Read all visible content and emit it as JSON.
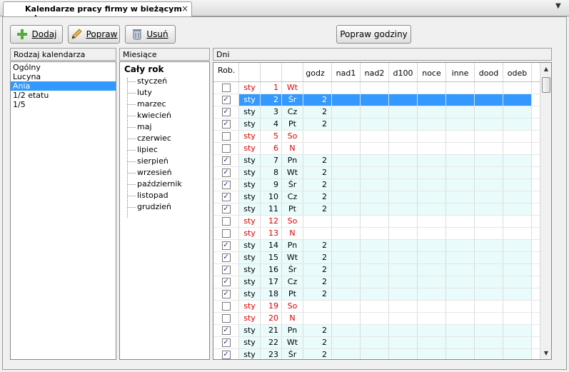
{
  "tab": {
    "title": "Kalendarze pracy firmy w bieżącym roku",
    "close": "×",
    "menu": "▼"
  },
  "toolbar": {
    "add_label": "Dodaj",
    "add_icon": "plus-icon",
    "edit_label": "Popraw",
    "edit_icon": "pencil-icon",
    "delete_label": "Usuń",
    "delete_icon": "trash-icon",
    "hours_label": "Popraw godziny"
  },
  "calendars": {
    "header": "Rodzaj kalendarza",
    "items": [
      "Ogólny",
      "Lucyna",
      "Ania",
      "1/2 etatu",
      "1/5"
    ],
    "selected": "Ania"
  },
  "months": {
    "header": "Miesiące",
    "root": "Cały rok",
    "items": [
      "styczeń",
      "luty",
      "marzec",
      "kwiecień",
      "maj",
      "czerwiec",
      "lipiec",
      "sierpień",
      "wrzesień",
      "październik",
      "listopad",
      "grudzień"
    ]
  },
  "days": {
    "header": "Dni",
    "columns": [
      "Rob.",
      "",
      "",
      "",
      "godz",
      "nad1",
      "nad2",
      "d100",
      "noce",
      "inne",
      "dood",
      "odeb"
    ],
    "rows": [
      {
        "checked": false,
        "month": "sty",
        "day": "1",
        "weekday": "Wt",
        "hours": "",
        "type": "off"
      },
      {
        "checked": true,
        "month": "sty",
        "day": "2",
        "weekday": "Śr",
        "hours": "2",
        "type": "selected"
      },
      {
        "checked": true,
        "month": "sty",
        "day": "3",
        "weekday": "Cz",
        "hours": "2",
        "type": "work"
      },
      {
        "checked": true,
        "month": "sty",
        "day": "4",
        "weekday": "Pt",
        "hours": "2",
        "type": "work"
      },
      {
        "checked": false,
        "month": "sty",
        "day": "5",
        "weekday": "So",
        "hours": "",
        "type": "off"
      },
      {
        "checked": false,
        "month": "sty",
        "day": "6",
        "weekday": "N",
        "hours": "",
        "type": "off"
      },
      {
        "checked": true,
        "month": "sty",
        "day": "7",
        "weekday": "Pn",
        "hours": "2",
        "type": "work"
      },
      {
        "checked": true,
        "month": "sty",
        "day": "8",
        "weekday": "Wt",
        "hours": "2",
        "type": "work"
      },
      {
        "checked": true,
        "month": "sty",
        "day": "9",
        "weekday": "Śr",
        "hours": "2",
        "type": "work"
      },
      {
        "checked": true,
        "month": "sty",
        "day": "10",
        "weekday": "Cz",
        "hours": "2",
        "type": "work"
      },
      {
        "checked": true,
        "month": "sty",
        "day": "11",
        "weekday": "Pt",
        "hours": "2",
        "type": "work"
      },
      {
        "checked": false,
        "month": "sty",
        "day": "12",
        "weekday": "So",
        "hours": "",
        "type": "off"
      },
      {
        "checked": false,
        "month": "sty",
        "day": "13",
        "weekday": "N",
        "hours": "",
        "type": "off"
      },
      {
        "checked": true,
        "month": "sty",
        "day": "14",
        "weekday": "Pn",
        "hours": "2",
        "type": "work"
      },
      {
        "checked": true,
        "month": "sty",
        "day": "15",
        "weekday": "Wt",
        "hours": "2",
        "type": "work"
      },
      {
        "checked": true,
        "month": "sty",
        "day": "16",
        "weekday": "Śr",
        "hours": "2",
        "type": "work"
      },
      {
        "checked": true,
        "month": "sty",
        "day": "17",
        "weekday": "Cz",
        "hours": "2",
        "type": "work"
      },
      {
        "checked": true,
        "month": "sty",
        "day": "18",
        "weekday": "Pt",
        "hours": "2",
        "type": "work"
      },
      {
        "checked": false,
        "month": "sty",
        "day": "19",
        "weekday": "So",
        "hours": "",
        "type": "off"
      },
      {
        "checked": false,
        "month": "sty",
        "day": "20",
        "weekday": "N",
        "hours": "",
        "type": "off"
      },
      {
        "checked": true,
        "month": "sty",
        "day": "21",
        "weekday": "Pn",
        "hours": "2",
        "type": "work"
      },
      {
        "checked": true,
        "month": "sty",
        "day": "22",
        "weekday": "Wt",
        "hours": "2",
        "type": "work"
      },
      {
        "checked": true,
        "month": "sty",
        "day": "23",
        "weekday": "Śr",
        "hours": "2",
        "type": "work"
      }
    ]
  },
  "colors": {
    "selection": "#3399ff",
    "workday_bg": "#e9fbfb",
    "holiday_text": "#e00000"
  }
}
